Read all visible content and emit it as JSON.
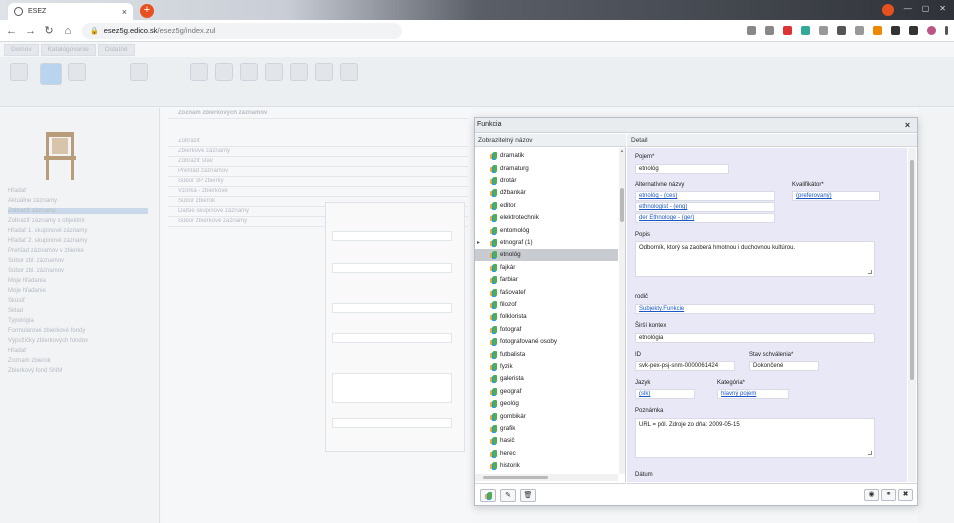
{
  "browser": {
    "tab_title": "ESEZ",
    "tab_close": "×",
    "new_tab": "+",
    "url_host": "esez5g.edico.sk",
    "url_path": "/esez5g/index.zul"
  },
  "modal": {
    "title": "Funkcia",
    "close": "×",
    "list_header": "Zobrazitelný názov",
    "detail_header": "Detail",
    "list_items": [
      {
        "label": "dramatik",
        "expander": "",
        "selected": false
      },
      {
        "label": "dramaturg",
        "expander": "",
        "selected": false
      },
      {
        "label": "drotár",
        "expander": "",
        "selected": false
      },
      {
        "label": "džbankár",
        "expander": "",
        "selected": false
      },
      {
        "label": "editor",
        "expander": "",
        "selected": false
      },
      {
        "label": "elektrotechnik",
        "expander": "",
        "selected": false
      },
      {
        "label": "entomológ",
        "expander": "",
        "selected": false
      },
      {
        "label": "etnograf (1)",
        "expander": "▸",
        "selected": false
      },
      {
        "label": "etnológ",
        "expander": "",
        "selected": true
      },
      {
        "label": "fajkár",
        "expander": "",
        "selected": false
      },
      {
        "label": "farbiar",
        "expander": "",
        "selected": false
      },
      {
        "label": "fašovateľ",
        "expander": "",
        "selected": false
      },
      {
        "label": "filozof",
        "expander": "",
        "selected": false
      },
      {
        "label": "folklorista",
        "expander": "",
        "selected": false
      },
      {
        "label": "fotograf",
        "expander": "",
        "selected": false
      },
      {
        "label": "fotografované osoby",
        "expander": "",
        "selected": false
      },
      {
        "label": "futbalista",
        "expander": "",
        "selected": false
      },
      {
        "label": "fyzik",
        "expander": "",
        "selected": false
      },
      {
        "label": "galerista",
        "expander": "",
        "selected": false
      },
      {
        "label": "geograf",
        "expander": "",
        "selected": false
      },
      {
        "label": "geológ",
        "expander": "",
        "selected": false
      },
      {
        "label": "gombikár",
        "expander": "",
        "selected": false
      },
      {
        "label": "grafik",
        "expander": "",
        "selected": false
      },
      {
        "label": "hasič",
        "expander": "",
        "selected": false
      },
      {
        "label": "herec",
        "expander": "",
        "selected": false
      },
      {
        "label": "historik",
        "expander": "",
        "selected": false
      }
    ],
    "list_footer_buttons": [
      "add-icon",
      "edit-icon",
      "delete-icon"
    ],
    "detail": {
      "pojem_label": "Pojem*",
      "pojem_value": "etnológ",
      "alt_label": "Alternatívne názvy",
      "alt_values": [
        "etnológ - (ces)",
        "ethnologist - (eng)",
        "der Ethnologe - (ger)"
      ],
      "kvalifikator_label": "Kvalifikátor*",
      "kvalifikator_value": "(preferovaný)",
      "popis_label": "Popis",
      "popis_value": "Odborník, ktorý sa zaoberá hmotnou i duchovnou kultúrou.",
      "rodic_label": "rodič",
      "rodic_value": "Subjekty.Funkcie",
      "siri_label": "Širší kontex",
      "siri_value": "etnológia",
      "id_label": "ID",
      "id_value": "svk-pex-psj-snm-0000061424",
      "stav_label": "Stav schválenia*",
      "stav_value": "Dokončené",
      "jazyk_label": "Jazyk",
      "jazyk_value": "(slk)",
      "kategoria_label": "Kategória*",
      "kategoria_value": "hlavný pojem",
      "poznamka_label": "Poznámka",
      "poznamka_value": "URL = pôl. Zdroje zo dňa: 2009-05-15",
      "datum_label": "Dátum"
    },
    "detail_footer_buttons": [
      "eye-icon",
      "link-icon",
      "close-icon"
    ]
  },
  "background": {
    "ribbon_tabs": [
      "Domov",
      "Katalógovanie",
      "Ostatné"
    ],
    "left_rows": [
      "Hľadať",
      "Aktuálne záznamy",
      "Zobraziť záznamy",
      "Zobraziť záznamy s objektmi",
      "Hľadať 1. skupinové záznamy",
      "Hľadať 2. skupinové záznamy",
      "Prehľad záznamov v zbierke",
      "Súbor zbl. záznamov",
      "Súbor zbl. záznamov",
      "Moje hľadania",
      "Moje hľadanie",
      "Skúsiť",
      "Sklad",
      "Typológia",
      "Formulárové zbierkové fondy",
      "Výpožičky zbierkových fondov",
      "Hľadať",
      "Zoznam zbierok",
      "Zbierkový fond SNM"
    ],
    "mid_rows": [
      "Zobraziť",
      "Zbierkové záznamy",
      "Zobraziť stav",
      "Prehľad záznamov",
      "Súbor 3P zbierky",
      "Vzorka - zbierkové",
      "Súbor zbierok",
      "Ďalšie skupinové záznamy",
      "Súbor zbierkové záznamy"
    ],
    "panel_title": "Zoznam zbierkových záznamov"
  }
}
